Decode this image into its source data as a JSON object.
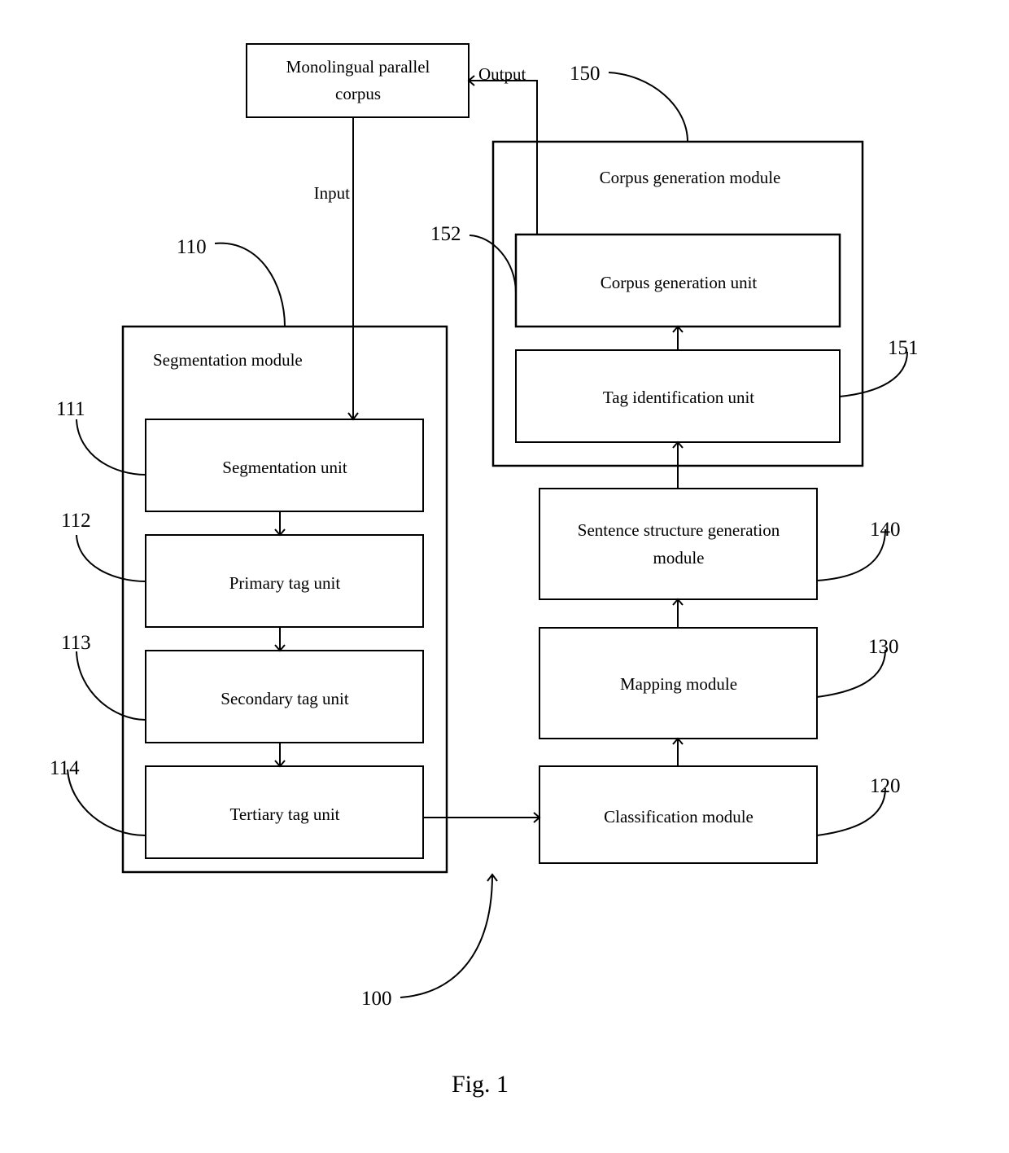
{
  "figure": {
    "caption": "Fig. 1",
    "system_ref": "100"
  },
  "corpus_box": {
    "label_lines": [
      "Monolingual parallel",
      "corpus"
    ]
  },
  "flows": {
    "input_label": "Input",
    "output_label": "Output"
  },
  "segmentation_module": {
    "ref": "110",
    "title": "Segmentation module",
    "units": [
      {
        "ref": "111",
        "label": "Segmentation unit"
      },
      {
        "ref": "112",
        "label": "Primary tag unit"
      },
      {
        "ref": "113",
        "label": "Secondary tag unit"
      },
      {
        "ref": "114",
        "label": "Tertiary tag unit"
      }
    ]
  },
  "classification_module": {
    "ref": "120",
    "label": "Classification module"
  },
  "mapping_module": {
    "ref": "130",
    "label": "Mapping module"
  },
  "sentence_structure_module": {
    "ref": "140",
    "label_lines": [
      "Sentence structure generation",
      "module"
    ]
  },
  "corpus_generation_module": {
    "ref": "150",
    "title": "Corpus generation module",
    "units": [
      {
        "ref": "151",
        "label": "Tag identification unit"
      },
      {
        "ref": "152",
        "label": "Corpus generation unit"
      }
    ]
  }
}
